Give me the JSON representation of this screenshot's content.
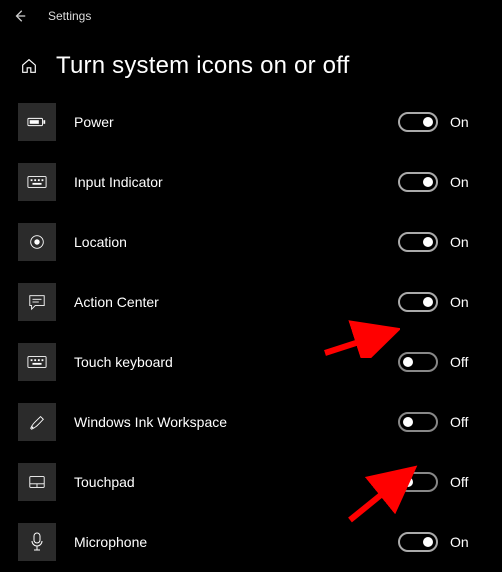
{
  "titlebar": {
    "title": "Settings"
  },
  "page": {
    "heading": "Turn system icons on or off"
  },
  "state_labels": {
    "on": "On",
    "off": "Off"
  },
  "items": [
    {
      "id": "power",
      "label": "Power",
      "on": true
    },
    {
      "id": "input-indicator",
      "label": "Input Indicator",
      "on": true
    },
    {
      "id": "location",
      "label": "Location",
      "on": true
    },
    {
      "id": "action-center",
      "label": "Action Center",
      "on": true
    },
    {
      "id": "touch-keyboard",
      "label": "Touch keyboard",
      "on": false
    },
    {
      "id": "ink-workspace",
      "label": "Windows Ink Workspace",
      "on": false
    },
    {
      "id": "touchpad",
      "label": "Touchpad",
      "on": false
    },
    {
      "id": "microphone",
      "label": "Microphone",
      "on": true
    }
  ],
  "annotations": {
    "arrows": [
      {
        "target": "touch-keyboard"
      },
      {
        "target": "touchpad"
      }
    ],
    "color": "#ff0000"
  }
}
